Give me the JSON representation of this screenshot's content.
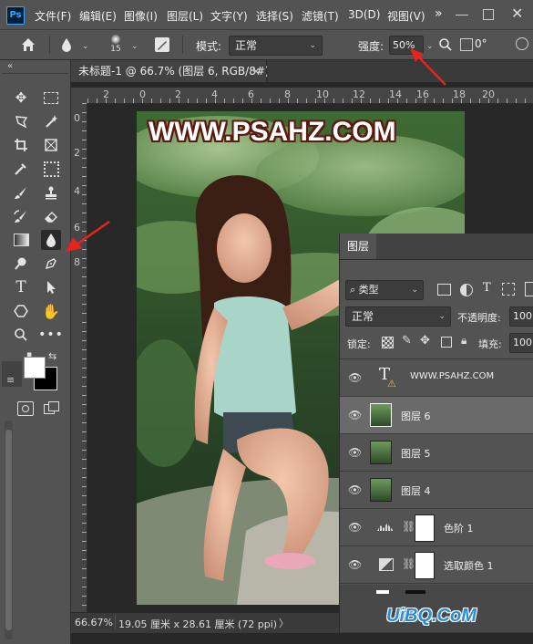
{
  "app": {
    "logo": "Ps",
    "menu": [
      "文件(F)",
      "编辑(E)",
      "图像(I)",
      "图层(L)",
      "文字(Y)",
      "选择(S)",
      "滤镜(T)",
      "3D(D)",
      "视图(V)"
    ]
  },
  "options": {
    "brush_size": "15",
    "mode_label": "模式:",
    "mode_value": "正常",
    "strength_label": "强度:",
    "strength_value": "50%",
    "angle_value": "0°"
  },
  "tab": {
    "title": "未标题-1 @ 66.7% (图层 6, RGB/8#) *",
    "close": "×"
  },
  "ruler": {
    "h_ticks": [
      "2",
      "0",
      "2",
      "4",
      "6",
      "8",
      "10",
      "12",
      "14",
      "16",
      "18",
      "20"
    ],
    "v_ticks": [
      "0",
      "2",
      "4",
      "6",
      "8"
    ]
  },
  "canvas": {
    "watermark": "WWW.PSAHZ.COM"
  },
  "status": {
    "zoom": "66.67%",
    "doc_size": "19.05 厘米 x 28.61 厘米 (72 ppi)",
    "arrow": "〉"
  },
  "layers_panel": {
    "title": "图层",
    "filter_type": "类型",
    "blend_mode": "正常",
    "opacity_label": "不透明度:",
    "opacity_value": "100",
    "lock_label": "锁定:",
    "fill_label": "填充:",
    "fill_value": "100",
    "layers": [
      {
        "name": "WWW.PSAHZ.COM",
        "kind": "text",
        "selected": false
      },
      {
        "name": "图层 6",
        "kind": "image",
        "selected": true
      },
      {
        "name": "图层 5",
        "kind": "image",
        "selected": false
      },
      {
        "name": "图层 4",
        "kind": "image",
        "selected": false
      },
      {
        "name": "色阶 1",
        "kind": "levels",
        "selected": false
      },
      {
        "name": "选取颜色 1",
        "kind": "selective-color",
        "selected": false
      }
    ]
  },
  "site_watermark": "UiBQ.CoM",
  "colors": {
    "arrow_red": "#e8231d",
    "ps_blue": "#31a8ff"
  }
}
